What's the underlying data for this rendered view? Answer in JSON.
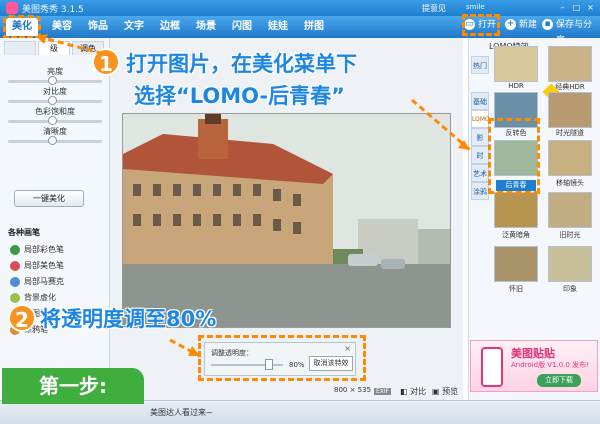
{
  "app": {
    "title": "美图秀秀 3.1.5",
    "user": "提意见",
    "username": "smile"
  },
  "nav": {
    "tabs": [
      "美化",
      "美容",
      "饰品",
      "文字",
      "边框",
      "场景",
      "闪图",
      "娃娃",
      "拼图"
    ],
    "active_tab": "美化",
    "open_label": "打开",
    "new_label": "新建",
    "save_label": "保存与分享"
  },
  "left_panel": {
    "tabs": [
      "",
      "级",
      "调色"
    ],
    "sliders": [
      {
        "label": "亮度",
        "value": 0.5
      },
      {
        "label": "对比度",
        "value": 0.5
      },
      {
        "label": "色彩饱和度",
        "value": 0.5
      },
      {
        "label": "清晰度",
        "value": 0.5
      }
    ],
    "one_key_label": "一键美化",
    "brush_title": "各种画笔",
    "brushes": [
      "局部彩色笔",
      "局部美色笔",
      "局部马赛克",
      "背景虚化",
      "抠图笔",
      "涂鸦笔"
    ]
  },
  "canvas": {
    "size_readout": "800 × 535",
    "exif_label": "EXIF",
    "compare_label": "对比",
    "preview_label": "预览"
  },
  "dialog": {
    "label": "调整透明度：",
    "value": 0.8,
    "percent_text": "80%",
    "cancel_label": "取消该特效"
  },
  "right_panel": {
    "header": "LOMO特效",
    "categories": [
      "热门",
      "基础",
      "LOMO",
      "影",
      "时",
      "艺术",
      "涂鸦"
    ],
    "active_category": "LOMO",
    "effects": [
      {
        "label": "HDR",
        "color": "#d8c79a"
      },
      {
        "label": "经典HDR",
        "color": "#c9b285"
      },
      {
        "label": "反转色",
        "color": "#6c8fa8"
      },
      {
        "label": "时光隧道",
        "color": "#b89a70"
      },
      {
        "label": "后青春",
        "color": "#9fb89c"
      },
      {
        "label": "移轴镜头",
        "color": "#c7b080"
      },
      {
        "label": "泛黄暗角",
        "color": "#b7954f"
      },
      {
        "label": "旧时光",
        "color": "#c2ad82"
      },
      {
        "label": "怀旧",
        "color": "#a89468"
      },
      {
        "label": "印象",
        "color": "#c7c09a"
      }
    ],
    "selected_effect": "后青春"
  },
  "ad": {
    "title": "美图贴贴",
    "subtitle": "Android版 V1.0.0 发布!",
    "button": "立即下载"
  },
  "status": {
    "message": "美图达人看过来~"
  },
  "tutorial": {
    "step_badge": "第一步:",
    "step1_number": "1",
    "step1_line1": "打开图片，在美化菜单下",
    "step1_line2": "选择“LOMO-后青春”",
    "step2_number": "2",
    "step2_text": "将透明度调至80%"
  },
  "colors": {
    "accent": "#1d86e3",
    "highlight": "#ff8a00",
    "badge": "#3fae3f"
  }
}
